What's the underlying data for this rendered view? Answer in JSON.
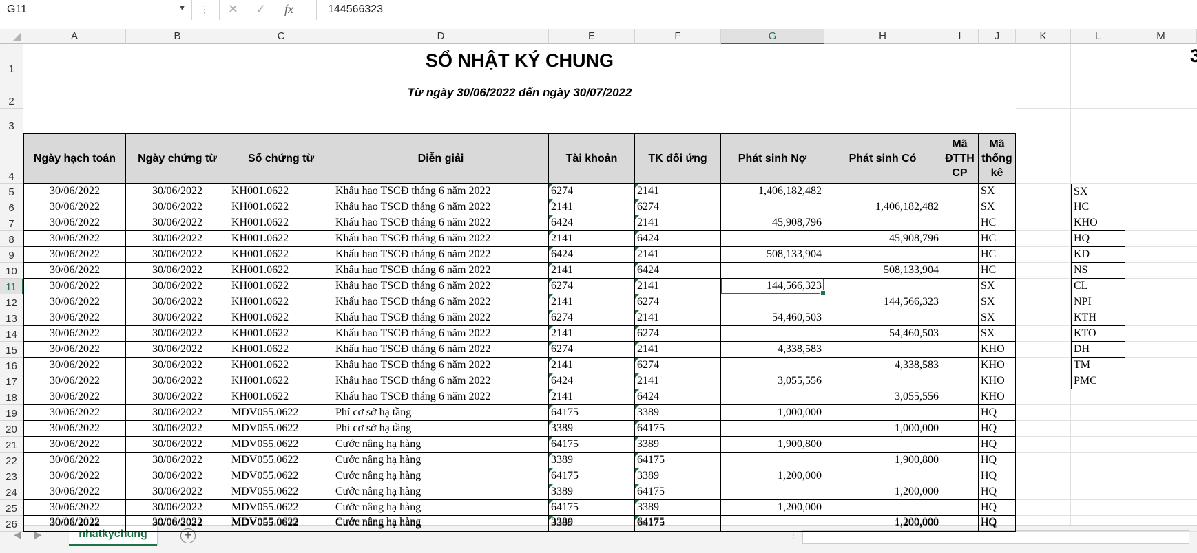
{
  "formula_bar": {
    "name_box": "G11",
    "content": "144566323",
    "cancel_icon": "x-icon",
    "enter_icon": "check-icon",
    "fx_label": "fx"
  },
  "column_headers": [
    "A",
    "B",
    "C",
    "D",
    "E",
    "F",
    "G",
    "H",
    "I",
    "J",
    "K",
    "L",
    "M"
  ],
  "selected_column": "G",
  "selected_row": "11",
  "sheet": {
    "title": "SỔ NHẬT KÝ CHUNG",
    "subtitle": "Từ ngày 30/06/2022 đến ngày 30/07/2022",
    "headers": [
      "Ngày hạch toán",
      "Ngày chứng từ",
      "Số chứng từ",
      "Diễn giải",
      "Tài khoản",
      "TK đối ứng",
      "Phát sinh Nợ",
      "Phát sinh Có",
      "Mã ĐTTH CP",
      "Mã thống kê"
    ],
    "rows": [
      [
        "30/06/2022",
        "30/06/2022",
        "KH001.0622",
        "Khấu hao TSCĐ tháng 6 năm 2022",
        "6274",
        "2141",
        "1,406,182,482",
        "",
        "",
        "SX"
      ],
      [
        "30/06/2022",
        "30/06/2022",
        "KH001.0622",
        "Khấu hao TSCĐ tháng 6 năm 2022",
        "2141",
        "6274",
        "",
        "1,406,182,482",
        "",
        "SX"
      ],
      [
        "30/06/2022",
        "30/06/2022",
        "KH001.0622",
        "Khấu hao TSCĐ tháng 6 năm 2022",
        "6424",
        "2141",
        "45,908,796",
        "",
        "",
        "HC"
      ],
      [
        "30/06/2022",
        "30/06/2022",
        "KH001.0622",
        "Khấu hao TSCĐ tháng 6 năm 2022",
        "2141",
        "6424",
        "",
        "45,908,796",
        "",
        "HC"
      ],
      [
        "30/06/2022",
        "30/06/2022",
        "KH001.0622",
        "Khấu hao TSCĐ tháng 6 năm 2022",
        "6424",
        "2141",
        "508,133,904",
        "",
        "",
        "HC"
      ],
      [
        "30/06/2022",
        "30/06/2022",
        "KH001.0622",
        "Khấu hao TSCĐ tháng 6 năm 2022",
        "2141",
        "6424",
        "",
        "508,133,904",
        "",
        "HC"
      ],
      [
        "30/06/2022",
        "30/06/2022",
        "KH001.0622",
        "Khấu hao TSCĐ tháng 6 năm 2022",
        "6274",
        "2141",
        "144,566,323",
        "",
        "",
        "SX"
      ],
      [
        "30/06/2022",
        "30/06/2022",
        "KH001.0622",
        "Khấu hao TSCĐ tháng 6 năm 2022",
        "2141",
        "6274",
        "",
        "144,566,323",
        "",
        "SX"
      ],
      [
        "30/06/2022",
        "30/06/2022",
        "KH001.0622",
        "Khấu hao TSCĐ tháng 6 năm 2022",
        "6274",
        "2141",
        "54,460,503",
        "",
        "",
        "SX"
      ],
      [
        "30/06/2022",
        "30/06/2022",
        "KH001.0622",
        "Khấu hao TSCĐ tháng 6 năm 2022",
        "2141",
        "6274",
        "",
        "54,460,503",
        "",
        "SX"
      ],
      [
        "30/06/2022",
        "30/06/2022",
        "KH001.0622",
        "Khấu hao TSCĐ tháng 6 năm 2022",
        "6274",
        "2141",
        "4,338,583",
        "",
        "",
        "KHO"
      ],
      [
        "30/06/2022",
        "30/06/2022",
        "KH001.0622",
        "Khấu hao TSCĐ tháng 6 năm 2022",
        "2141",
        "6274",
        "",
        "4,338,583",
        "",
        "KHO"
      ],
      [
        "30/06/2022",
        "30/06/2022",
        "KH001.0622",
        "Khấu hao TSCĐ tháng 6 năm 2022",
        "6424",
        "2141",
        "3,055,556",
        "",
        "",
        "KHO"
      ],
      [
        "30/06/2022",
        "30/06/2022",
        "KH001.0622",
        "Khấu hao TSCĐ tháng 6 năm 2022",
        "2141",
        "6424",
        "",
        "3,055,556",
        "",
        "KHO"
      ],
      [
        "30/06/2022",
        "30/06/2022",
        "MDV055.0622",
        "Phí cơ sở hạ tầng",
        "64175",
        "3389",
        "1,000,000",
        "",
        "",
        "HQ"
      ],
      [
        "30/06/2022",
        "30/06/2022",
        "MDV055.0622",
        "Phí cơ sở hạ tầng",
        "3389",
        "64175",
        "",
        "1,000,000",
        "",
        "HQ"
      ],
      [
        "30/06/2022",
        "30/06/2022",
        "MDV055.0622",
        "Cước nâng hạ hàng",
        "64175",
        "3389",
        "1,900,800",
        "",
        "",
        "HQ"
      ],
      [
        "30/06/2022",
        "30/06/2022",
        "MDV055.0622",
        "Cước nâng hạ hàng",
        "3389",
        "64175",
        "",
        "1,900,800",
        "",
        "HQ"
      ],
      [
        "30/06/2022",
        "30/06/2022",
        "MDV055.0622",
        "Cước nâng hạ hàng",
        "64175",
        "3389",
        "1,200,000",
        "",
        "",
        "HQ"
      ],
      [
        "30/06/2022",
        "30/06/2022",
        "MDV055.0622",
        "Cước nâng hạ hàng",
        "3389",
        "64175",
        "",
        "1,200,000",
        "",
        "HQ"
      ],
      [
        "30/06/2022",
        "30/06/2022",
        "MDV055.0622",
        "Cước nâng hạ hàng",
        "64175",
        "3389",
        "1,200,000",
        "",
        "",
        "HQ"
      ],
      [
        "30/06/2022",
        "30/06/2022",
        "MDV055.0622",
        "Cước nâng hạ hàng",
        "3389",
        "64175",
        "",
        "1,200,000",
        "",
        "HQ"
      ]
    ],
    "code_list": [
      "SX",
      "HC",
      "KHO",
      "HQ",
      "KD",
      "NS",
      "CL",
      "NPI",
      "KTH",
      "KTO",
      "DH",
      "TM",
      "PMC"
    ],
    "edge_fragment": "3"
  },
  "tabs": {
    "active_sheet": "nhatkychung",
    "add_label": "+"
  },
  "colors": {
    "accent": "#217346",
    "header_fill": "#d9d9d9"
  }
}
